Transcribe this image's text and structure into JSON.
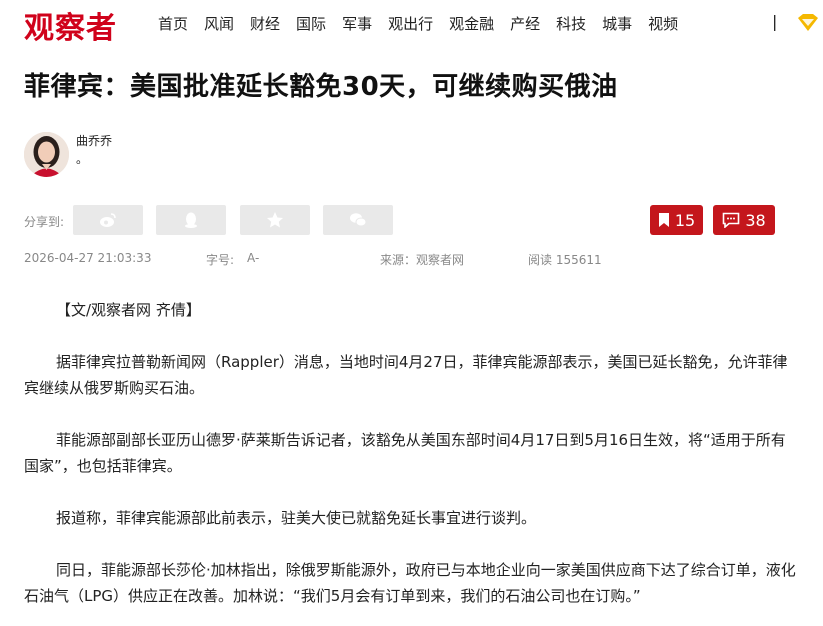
{
  "header": {
    "logo": "观察者",
    "nav": [
      "首页",
      "风闻",
      "财经",
      "国际",
      "军事",
      "观出行",
      "观金融",
      "产经",
      "科技",
      "城事",
      "视频"
    ],
    "separator": "|",
    "vip_icon": "vip-diamond-icon",
    "brand_color": "#d0021b"
  },
  "article": {
    "title": "菲律宾：美国批准延长豁免30天，可继续购买俄油",
    "author": {
      "name": "曲乔乔",
      "desc": "。"
    },
    "share": {
      "label": "分享到:",
      "buttons": [
        "weibo-icon",
        "qq-icon",
        "qzone-star-icon",
        "wechat-icon"
      ]
    },
    "bookmark_count": "15",
    "comment_count": "38",
    "meta": {
      "date": "2026-04-27 21:03:33",
      "font_label": "字号:",
      "font_value": "A-",
      "source": "来源：观察者网",
      "reads": "阅读 155611"
    },
    "paragraphs": [
      "【文/观察者网 齐倩】",
      "据菲律宾拉普勒新闻网（Rappler）消息，当地时间4月27日，菲律宾能源部表示，美国已延长豁免，允许菲律宾继续从俄罗斯购买石油。",
      "菲能源部副部长亚历山德罗·萨莱斯告诉记者，该豁免从美国东部时间4月17日到5月16日生效，将“适用于所有国家”，也包括菲律宾。",
      "报道称，菲律宾能源部此前表示，驻美大使已就豁免延长事宜进行谈判。",
      "同日，菲能源部长莎伦·加林指出，除俄罗斯能源外，政府已与本地企业向一家美国供应商下达了综合订单，液化石油气（LPG）供应正在改善。加林说：“我们5月会有订单到来，我们的石油公司也在订购。”"
    ],
    "accent_color": "#c4161c"
  }
}
